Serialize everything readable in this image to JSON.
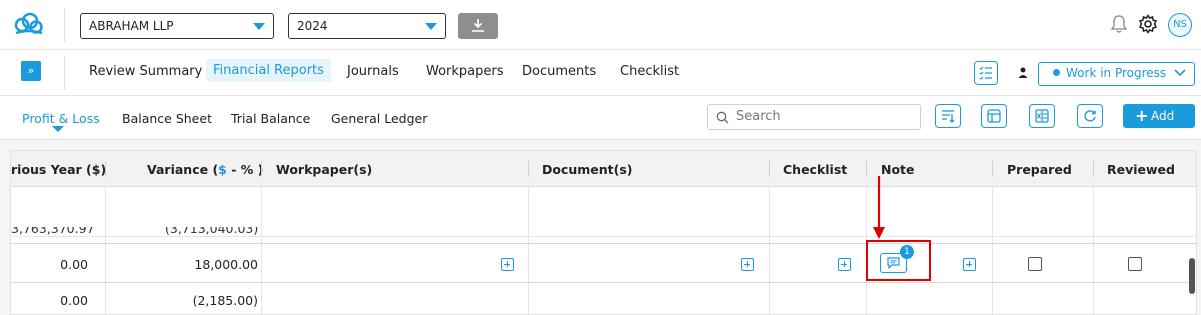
{
  "topbar": {
    "client_select": "ABRAHAM LLP",
    "year_select": "2024",
    "avatar_initials": "NS"
  },
  "nav": {
    "items": [
      "Review Summary",
      "Financial Reports",
      "Journals",
      "Workpapers",
      "Documents",
      "Checklist"
    ],
    "active_item": "Financial Reports",
    "status": "Work in Progress"
  },
  "tabs": {
    "items": [
      "Profit & Loss",
      "Balance Sheet",
      "Trial Balance",
      "General Ledger"
    ],
    "active": "Profit & Loss",
    "search_placeholder": "Search",
    "add_label": "Add"
  },
  "grid": {
    "headers": {
      "prev_year": "rious Year ($)",
      "variance_prefix": "Variance (",
      "variance_dollar": "$",
      "variance_suffix": " - % )",
      "workpapers": "Workpaper(s)",
      "documents": "Document(s)",
      "checklist": "Checklist",
      "note": "Note",
      "prepared": "Prepared",
      "reviewed": "Reviewed"
    },
    "partial_row": {
      "prev_year": "3,763,370.97",
      "variance": "(3,713,040.03)"
    },
    "rows": [
      {
        "prev_year": "0.00",
        "variance": "18,000.00",
        "note_count": "1"
      },
      {
        "prev_year": "0.00",
        "variance": "(2,185.00)"
      }
    ]
  },
  "colors": {
    "accent": "#1a9bdc",
    "highlight": "#e00000"
  }
}
